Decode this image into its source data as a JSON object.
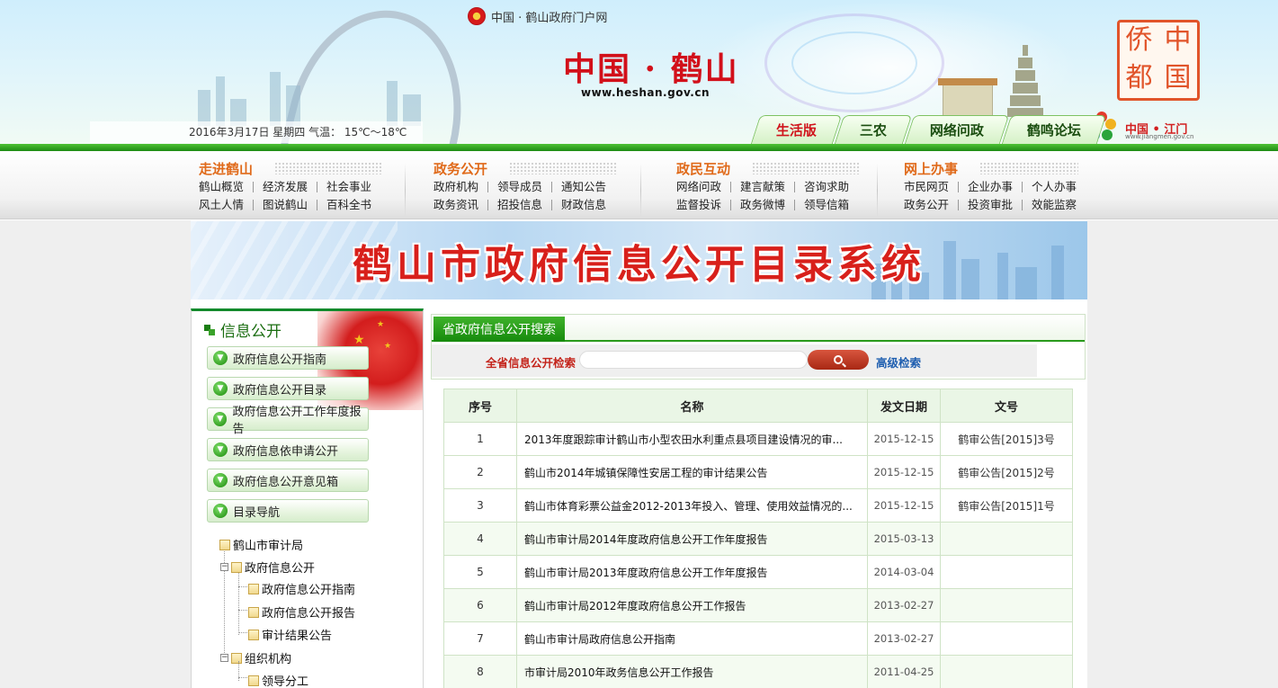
{
  "header": {
    "portal_text": "中国 · 鹤山政府门户网",
    "logo_text": "中国 · 鹤山",
    "logo_url": "www.heshan.gov.cn",
    "date_line": "2016年3月17日  星期四  气温：  15℃～18℃",
    "version_tabs": [
      {
        "label": "生活版",
        "active": true
      },
      {
        "label": "三农",
        "active": false
      },
      {
        "label": "网络问政",
        "active": false
      },
      {
        "label": "鹤鸣论坛",
        "active": false
      }
    ],
    "qiaodu_chars": [
      "侨",
      "中",
      "都",
      "国"
    ],
    "jiangmen_text": "中国 • 江门",
    "jiangmen_url": "www.jiangmen.gov.cn"
  },
  "nav": [
    {
      "title": "走进鹤山",
      "rows": [
        [
          "鹤山概览",
          "经济发展",
          "社会事业"
        ],
        [
          "风土人情",
          "图说鹤山",
          "百科全书"
        ]
      ]
    },
    {
      "title": "政务公开",
      "rows": [
        [
          "政府机构",
          "领导成员",
          "通知公告"
        ],
        [
          "政务资讯",
          "招投信息",
          "财政信息"
        ]
      ]
    },
    {
      "title": "政民互动",
      "rows": [
        [
          "网络问政",
          "建言献策",
          "咨询求助"
        ],
        [
          "监督投诉",
          "政务微博",
          "领导信箱"
        ]
      ]
    },
    {
      "title": "网上办事",
      "rows": [
        [
          "市民网页",
          "企业办事",
          "个人办事"
        ],
        [
          "政务公开",
          "投资审批",
          "效能监察"
        ]
      ]
    }
  ],
  "banner": {
    "title": "鹤山市政府信息公开目录系统"
  },
  "sidebar": {
    "title": "信息公开",
    "buttons": [
      "政府信息公开指南",
      "政府信息公开目录",
      "政府信息公开工作年度报告",
      "政府信息依申请公开",
      "政府信息公开意见箱",
      "目录导航"
    ],
    "tree": {
      "root": "鹤山市审计局",
      "n1": "政府信息公开",
      "n1a": "政府信息公开指南",
      "n1b": "政府信息公开报告",
      "n1c": "审计结果公告",
      "n2": "组织机构",
      "n2a": "领导分工"
    }
  },
  "search": {
    "tab_label": "省政府信息公开搜索",
    "field_label": "全省信息公开检索",
    "input_value": "",
    "input_placeholder": "",
    "advanced_label": "高级检索"
  },
  "table": {
    "headers": [
      "序号",
      "名称",
      "发文日期",
      "文号"
    ],
    "rows": [
      {
        "no": "1",
        "name": "2013年度跟踪审计鹤山市小型农田水利重点县项目建设情况的审...",
        "date": "2015-12-15",
        "doc": "鹤审公告[2015]3号"
      },
      {
        "no": "2",
        "name": "鹤山市2014年城镇保障性安居工程的审计结果公告",
        "date": "2015-12-15",
        "doc": "鹤审公告[2015]2号"
      },
      {
        "no": "3",
        "name": "鹤山市体育彩票公益金2012-2013年投入、管理、使用效益情况的...",
        "date": "2015-12-15",
        "doc": "鹤审公告[2015]1号"
      },
      {
        "no": "4",
        "name": "鹤山市审计局2014年度政府信息公开工作年度报告",
        "date": "2015-03-13",
        "doc": ""
      },
      {
        "no": "5",
        "name": "鹤山市审计局2013年度政府信息公开工作年度报告",
        "date": "2014-03-04",
        "doc": ""
      },
      {
        "no": "6",
        "name": "鹤山市审计局2012年度政府信息公开工作报告",
        "date": "2013-02-27",
        "doc": ""
      },
      {
        "no": "7",
        "name": "鹤山市审计局政府信息公开指南",
        "date": "2013-02-27",
        "doc": ""
      },
      {
        "no": "8",
        "name": "市审计局2010年政务信息公开工作报告",
        "date": "2011-04-25",
        "doc": ""
      }
    ]
  },
  "colors": {
    "brand_green": "#1e8a14",
    "brand_red": "#d2101a",
    "nav_orange": "#e06a1a",
    "link_blue": "#1f5fb0"
  }
}
